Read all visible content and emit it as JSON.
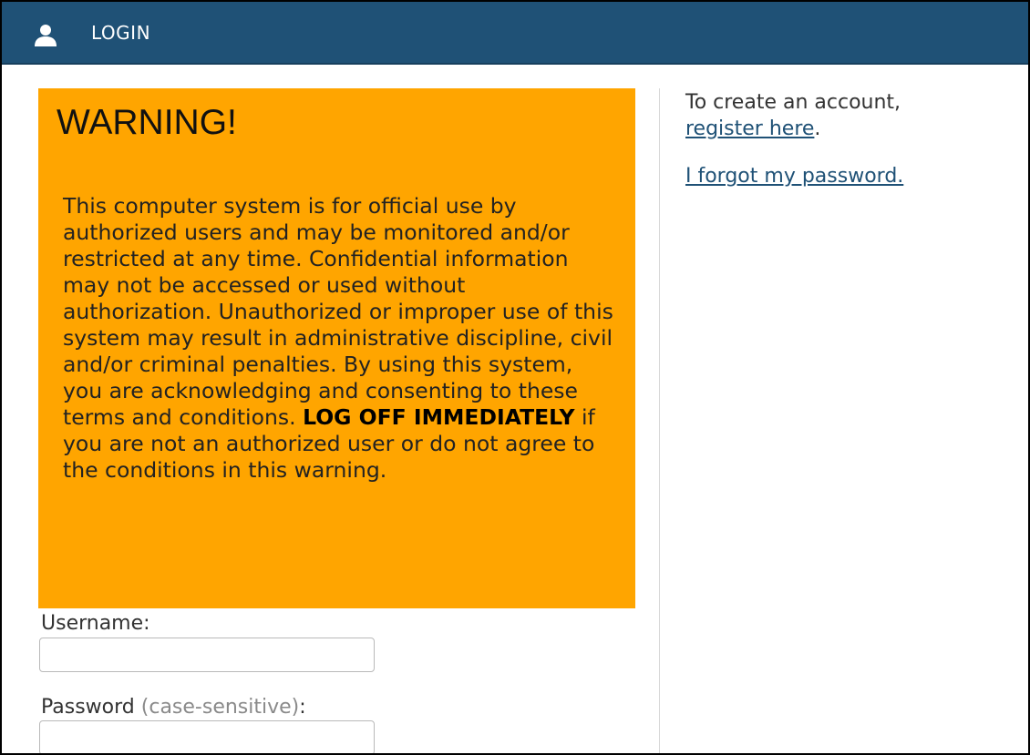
{
  "header": {
    "icon": "user-icon",
    "title": "LOGIN",
    "background_color": "#1f5176"
  },
  "warning": {
    "title": "WARNING!",
    "text_before_bold": "This computer system is for official use by authorized users and may be monitored and/or restricted at any time. Confidential information may not be accessed or used without authorization. Unauthorized or improper use of this system may result in administrative discipline, civil and/or criminal penalties. By using this system, you are acknowledging and consenting to these terms and conditions.",
    "bold_text": "LOG OFF IMMEDIATELY",
    "text_after_bold": "if you are not an authorized user or do not agree to the conditions in this warning.",
    "background_color": "#ffa500"
  },
  "sidebar": {
    "create_account_text": "To create an account,",
    "register_link": "register here",
    "register_suffix": ".",
    "forgot_password_link": "I forgot my password."
  },
  "form": {
    "username_label": "Username:",
    "username_value": "",
    "password_label": "Password",
    "password_hint": "(case-sensitive)",
    "password_suffix": ":",
    "password_value": ""
  }
}
